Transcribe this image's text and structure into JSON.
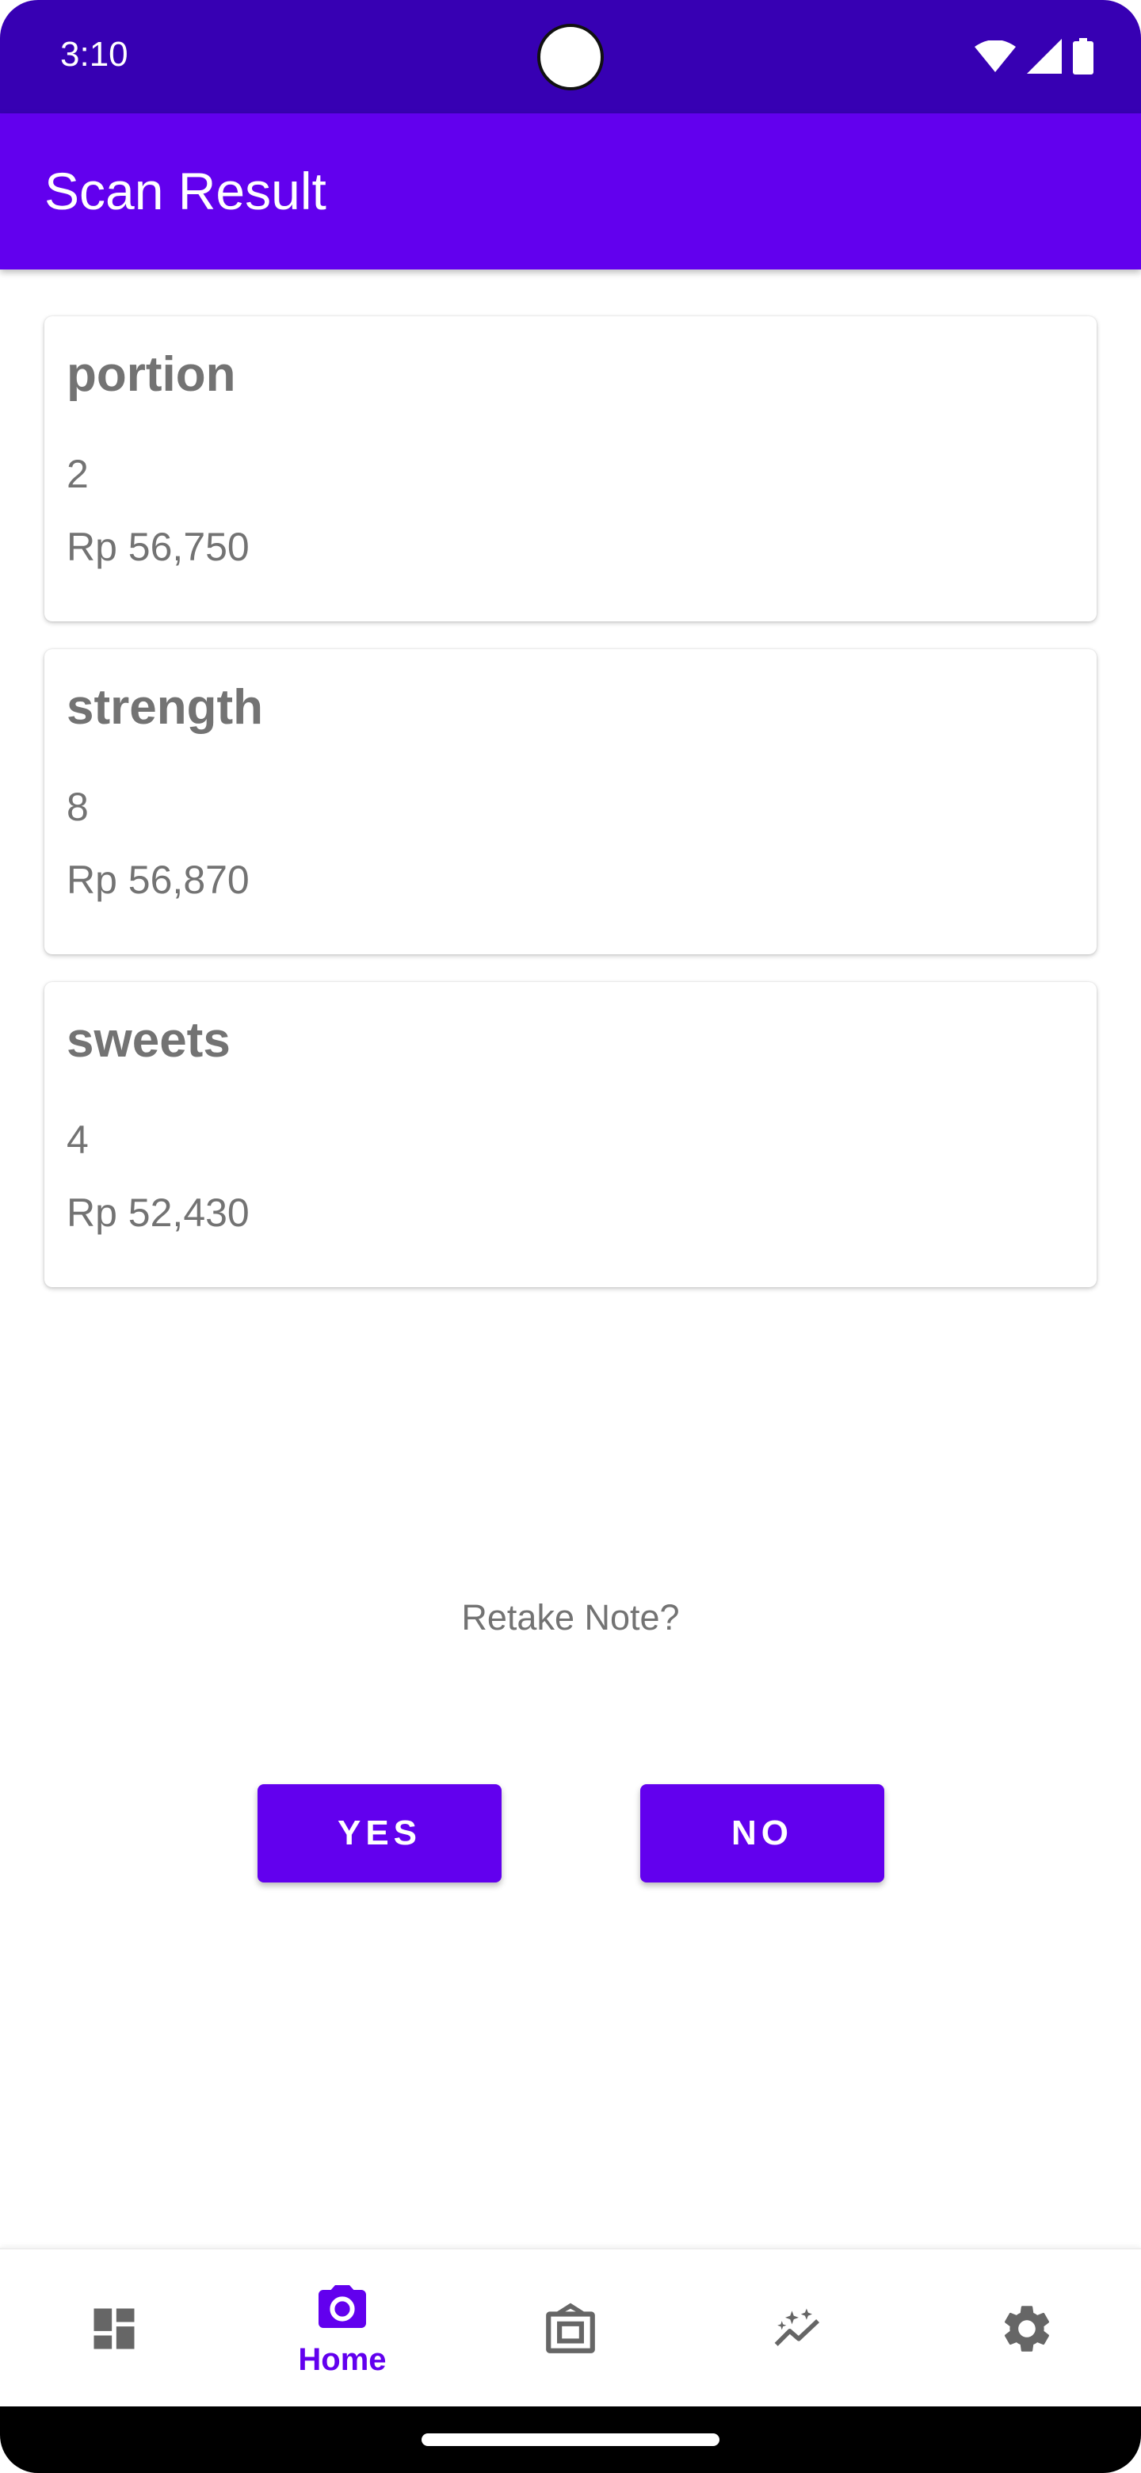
{
  "status_bar": {
    "time": "3:10"
  },
  "app_bar": {
    "title": "Scan Result"
  },
  "items": [
    {
      "name": "portion",
      "quantity": "2",
      "price": "Rp 56,750"
    },
    {
      "name": "strength",
      "quantity": "8",
      "price": "Rp 56,870"
    },
    {
      "name": "sweets",
      "quantity": "4",
      "price": "Rp 52,430"
    }
  ],
  "prompt": {
    "text": "Retake Note?",
    "yes_label": "YES",
    "no_label": "NO"
  },
  "bottom_nav": {
    "items": [
      {
        "icon": "dashboard-icon",
        "label": ""
      },
      {
        "icon": "camera-icon",
        "label": "Home"
      },
      {
        "icon": "wallet-icon",
        "label": ""
      },
      {
        "icon": "insights-icon",
        "label": ""
      },
      {
        "icon": "gear-icon",
        "label": ""
      }
    ],
    "active_index": 1
  },
  "colors": {
    "status_bar": "#3700b3",
    "primary": "#6200ee",
    "text_secondary": "#737373",
    "icon_inactive": "#666666"
  }
}
